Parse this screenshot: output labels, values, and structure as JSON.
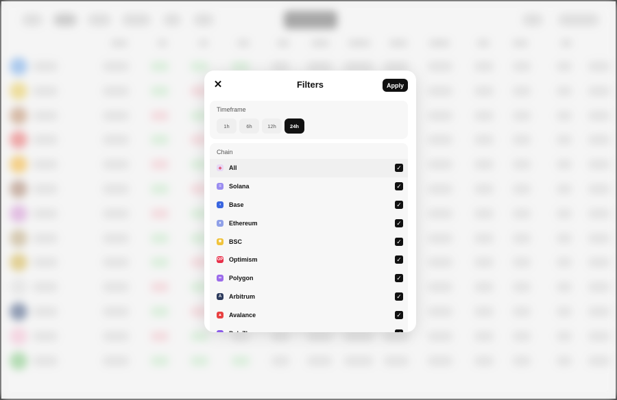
{
  "modal": {
    "title": "Filters",
    "apply_label": "Apply",
    "close_icon": "close-icon",
    "timeframe": {
      "label": "Timeframe",
      "options": [
        "1h",
        "6h",
        "12h",
        "24h"
      ],
      "selected": "24h"
    },
    "chain": {
      "label": "Chain",
      "items": [
        {
          "label": "All",
          "icon": "all-chains-icon",
          "color": "#e8d9f5",
          "checked": true
        },
        {
          "label": "Solana",
          "icon": "solana-icon",
          "color": "#9a8cf0",
          "checked": true
        },
        {
          "label": "Base",
          "icon": "base-icon",
          "color": "#3a66e0",
          "checked": true
        },
        {
          "label": "Ethereum",
          "icon": "ethereum-icon",
          "color": "#8fa0e8",
          "checked": true
        },
        {
          "label": "BSC",
          "icon": "bsc-icon",
          "color": "#f0c33c",
          "checked": true
        },
        {
          "label": "Optimism",
          "icon": "optimism-icon",
          "color": "#e8304a",
          "checked": true
        },
        {
          "label": "Polygon",
          "icon": "polygon-icon",
          "color": "#9b6bea",
          "checked": true
        },
        {
          "label": "Arbitrum",
          "icon": "arbitrum-icon",
          "color": "#2c3a5c",
          "checked": true
        },
        {
          "label": "Avalance",
          "icon": "avalanche-icon",
          "color": "#e84142",
          "checked": true
        },
        {
          "label": "Pol. Zkevm",
          "icon": "polygon-zkevm-icon",
          "color": "#8b5ce8",
          "checked": true
        }
      ]
    }
  },
  "colors": {
    "accent": "#111111",
    "panel": "#f7f7f7",
    "background": "#f2f2f2"
  }
}
